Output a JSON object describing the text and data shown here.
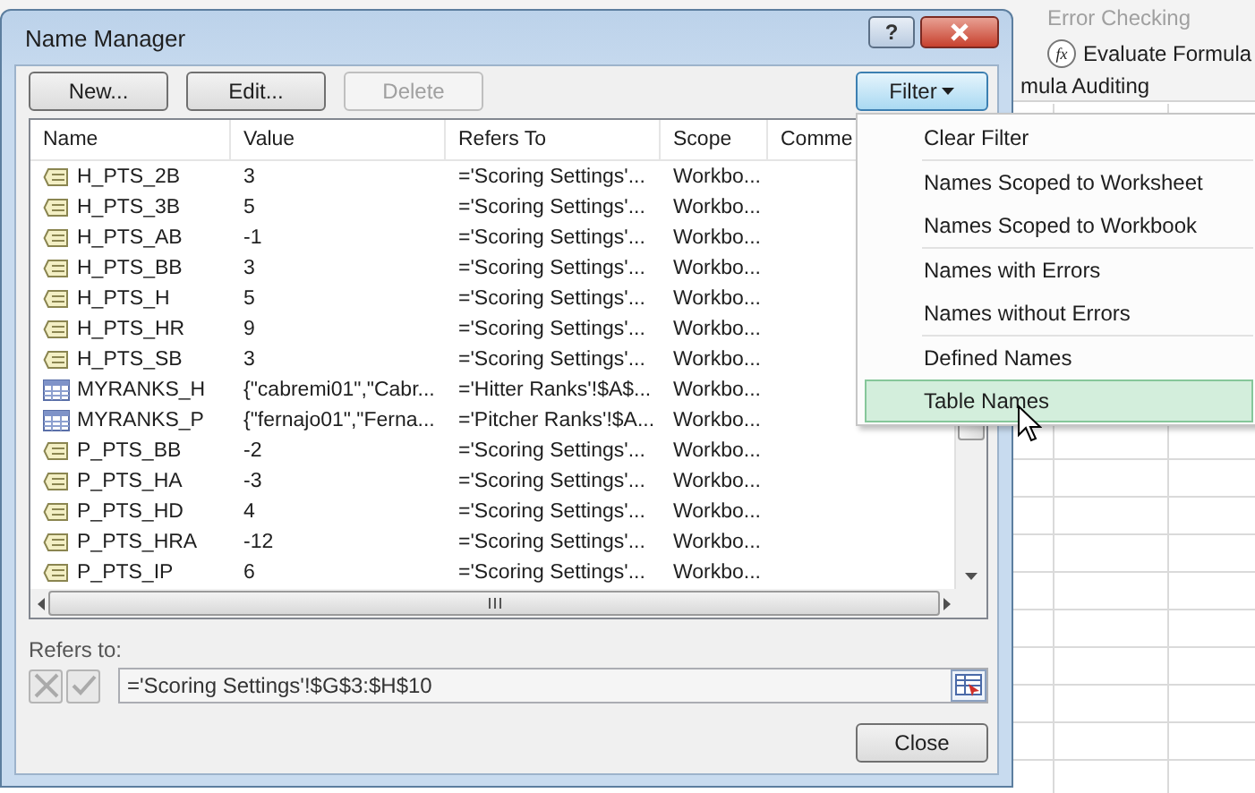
{
  "ribbon": {
    "items": [
      {
        "label": "Error Checking",
        "disabled": true
      },
      {
        "label": "Evaluate Formula",
        "disabled": false,
        "icon_text": "fx"
      }
    ],
    "group_label": "mula Auditing"
  },
  "dialog": {
    "title": "Name Manager",
    "help_button": "?",
    "buttons": [
      {
        "label": "New...",
        "disabled": false
      },
      {
        "label": "Edit...",
        "disabled": false
      },
      {
        "label": "Delete",
        "disabled": true
      }
    ],
    "filter_button": {
      "label": "Filter",
      "expanded": true
    },
    "table": {
      "columns": [
        "Name",
        "Value",
        "Refers To",
        "Scope",
        "Comme"
      ],
      "rows": [
        {
          "kind": "range",
          "cells": [
            "H_PTS_2B",
            "3",
            "='Scoring Settings'...",
            "Workbo..."
          ]
        },
        {
          "kind": "range",
          "cells": [
            "H_PTS_3B",
            "5",
            "='Scoring Settings'...",
            "Workbo..."
          ]
        },
        {
          "kind": "range",
          "cells": [
            "H_PTS_AB",
            "-1",
            "='Scoring Settings'...",
            "Workbo..."
          ]
        },
        {
          "kind": "range",
          "cells": [
            "H_PTS_BB",
            "3",
            "='Scoring Settings'...",
            "Workbo..."
          ]
        },
        {
          "kind": "range",
          "cells": [
            "H_PTS_H",
            "5",
            "='Scoring Settings'...",
            "Workbo..."
          ]
        },
        {
          "kind": "range",
          "cells": [
            "H_PTS_HR",
            "9",
            "='Scoring Settings'...",
            "Workbo..."
          ]
        },
        {
          "kind": "range",
          "cells": [
            "H_PTS_SB",
            "3",
            "='Scoring Settings'...",
            "Workbo..."
          ]
        },
        {
          "kind": "table",
          "cells": [
            "MYRANKS_H",
            "{\"cabremi01\",\"Cabr...",
            "='Hitter Ranks'!$A$...",
            "Workbo..."
          ]
        },
        {
          "kind": "table",
          "cells": [
            "MYRANKS_P",
            "{\"fernajo01\",\"Ferna...",
            "='Pitcher Ranks'!$A...",
            "Workbo..."
          ]
        },
        {
          "kind": "range",
          "cells": [
            "P_PTS_BB",
            "-2",
            "='Scoring Settings'...",
            "Workbo..."
          ]
        },
        {
          "kind": "range",
          "cells": [
            "P_PTS_HA",
            "-3",
            "='Scoring Settings'...",
            "Workbo..."
          ]
        },
        {
          "kind": "range",
          "cells": [
            "P_PTS_HD",
            "4",
            "='Scoring Settings'...",
            "Workbo..."
          ]
        },
        {
          "kind": "range",
          "cells": [
            "P_PTS_HRA",
            "-12",
            "='Scoring Settings'...",
            "Workbo..."
          ]
        },
        {
          "kind": "range",
          "cells": [
            "P_PTS_IP",
            "6",
            "='Scoring Settings'...",
            "Workbo..."
          ]
        }
      ]
    },
    "refers_to_label": "Refers to:",
    "refers_to_value": "='Scoring Settings'!$G$3:$H$10",
    "close_button": "Close"
  },
  "filter_menu": {
    "groups": [
      [
        {
          "label": "Clear Filter",
          "highlighted": false
        }
      ],
      [
        {
          "label": "Names Scoped to Worksheet",
          "highlighted": false
        },
        {
          "label": "Names Scoped to Workbook",
          "highlighted": false
        }
      ],
      [
        {
          "label": "Names with Errors",
          "highlighted": false
        },
        {
          "label": "Names without Errors",
          "highlighted": false
        }
      ],
      [
        {
          "label": "Defined Names",
          "highlighted": false
        },
        {
          "label": "Table Names",
          "highlighted": true
        }
      ]
    ]
  }
}
